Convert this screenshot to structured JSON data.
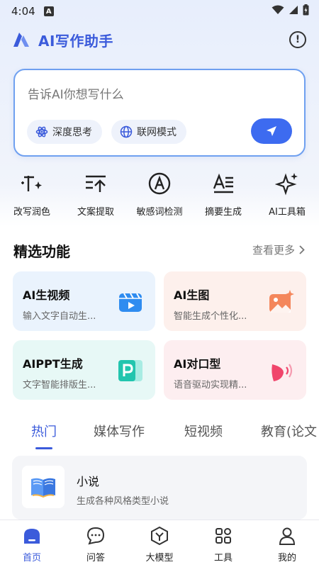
{
  "status_bar": {
    "time": "4:04",
    "notif_letter": "A"
  },
  "header": {
    "title": "AI写作助手",
    "logo_icon": "app-logo-icon",
    "info_icon": "info-icon"
  },
  "input": {
    "placeholder": "告诉AI你想写什么",
    "chips": [
      {
        "label": "深度思考",
        "icon": "atom-icon"
      },
      {
        "label": "联网模式",
        "icon": "globe-icon"
      }
    ],
    "send_icon": "send-icon",
    "accent": "#3d6bf0"
  },
  "tools": [
    {
      "label": "改写润色",
      "icon": "rewrite-icon"
    },
    {
      "label": "文案提取",
      "icon": "extract-text-icon"
    },
    {
      "label": "敏感词检测",
      "icon": "sensitive-check-icon"
    },
    {
      "label": "摘要生成",
      "icon": "summary-icon"
    },
    {
      "label": "AI工具箱",
      "icon": "sparkle-icon"
    }
  ],
  "featured": {
    "title": "精选功能",
    "see_more": "查看更多",
    "items": [
      {
        "title": "AI生视频",
        "subtitle": "输入文字自动生...",
        "icon": "video-icon",
        "bg": "#eaf3fd"
      },
      {
        "title": "AI生图",
        "subtitle": "智能生成个性化...",
        "icon": "image-icon",
        "bg": "#fdf0ec"
      },
      {
        "title": "AIPPT生成",
        "subtitle": "文字智能排版生...",
        "icon": "ppt-icon",
        "bg": "#e7f8f6"
      },
      {
        "title": "AI对口型",
        "subtitle": "语音驱动实现精...",
        "icon": "lip-sync-icon",
        "bg": "#fdeef0"
      }
    ]
  },
  "tabs": [
    "热门",
    "媒体写作",
    "短视频",
    "教育(论文"
  ],
  "list": [
    {
      "title": "小说",
      "subtitle": "生成各种风格类型小说",
      "icon": "book-icon"
    }
  ],
  "bottom_nav": [
    {
      "label": "首页",
      "icon": "home-icon",
      "active": true
    },
    {
      "label": "问答",
      "icon": "chat-icon",
      "active": false
    },
    {
      "label": "大模型",
      "icon": "model-icon",
      "active": false
    },
    {
      "label": "工具",
      "icon": "tools-grid-icon",
      "active": false
    },
    {
      "label": "我的",
      "icon": "profile-icon",
      "active": false
    }
  ]
}
